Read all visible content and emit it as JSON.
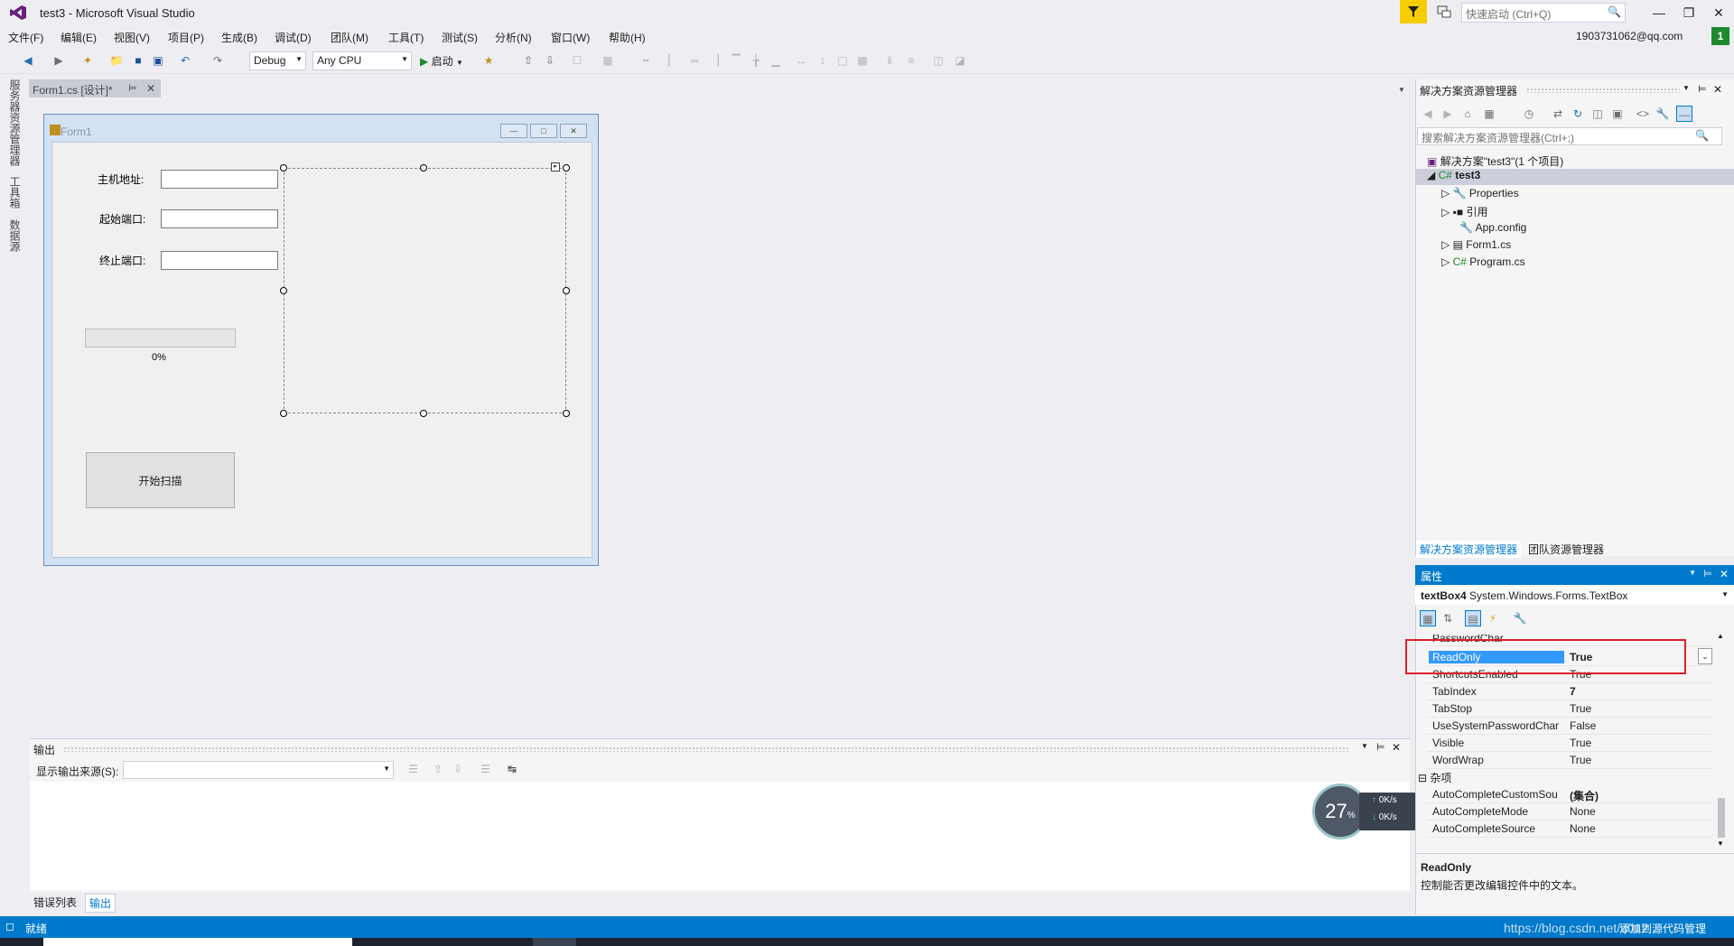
{
  "window": {
    "title": "test3 - Microsoft Visual Studio",
    "quick_launch_placeholder": "快速启动 (Ctrl+Q)",
    "account": "1903731062@qq.com",
    "notification_count": "1"
  },
  "menu": [
    "文件(F)",
    "编辑(E)",
    "视图(V)",
    "项目(P)",
    "生成(B)",
    "调试(D)",
    "团队(M)",
    "工具(T)",
    "测试(S)",
    "分析(N)",
    "窗口(W)",
    "帮助(H)"
  ],
  "toolbar": {
    "config": "Debug",
    "platform": "Any CPU",
    "start": "启动"
  },
  "left_tabs": [
    "服务器资源管理器",
    "工具箱",
    "数据源"
  ],
  "doc_tab": {
    "label": "Form1.cs [设计]*"
  },
  "form": {
    "title": "Form1",
    "host_label": "主机地址:",
    "start_port_label": "起始端口:",
    "end_port_label": "终止端口:",
    "progress_text": "0%",
    "progress_value": 0,
    "scan_button": "开始扫描"
  },
  "output": {
    "title": "输出",
    "source_label": "显示输出来源(S):",
    "tabs": [
      "错误列表",
      "输出"
    ]
  },
  "speed_widget": {
    "cpu": "27",
    "unit": "%",
    "up": "0K/s",
    "down": "0K/s"
  },
  "solution_explorer": {
    "title": "解决方案资源管理器",
    "search_placeholder": "搜索解决方案资源管理器(Ctrl+;)",
    "solution": "解决方案\"test3\"(1 个项目)",
    "project": "test3",
    "items": [
      "Properties",
      "引用",
      "App.config",
      "Form1.cs",
      "Program.cs"
    ],
    "tabs": [
      "解决方案资源管理器",
      "团队资源管理器"
    ]
  },
  "properties": {
    "title": "属性",
    "object_name": "textBox4",
    "object_type": "System.Windows.Forms.TextBox",
    "rows": [
      {
        "name": "PasswordChar",
        "value": ""
      },
      {
        "name": "ReadOnly",
        "value": "True"
      },
      {
        "name": "ShortcutsEnabled",
        "value": "True"
      },
      {
        "name": "TabIndex",
        "value": "7"
      },
      {
        "name": "TabStop",
        "value": "True"
      },
      {
        "name": "UseSystemPasswordChar",
        "value": "False"
      },
      {
        "name": "Visible",
        "value": "True"
      },
      {
        "name": "WordWrap",
        "value": "True"
      }
    ],
    "category": "杂项",
    "misc_rows": [
      {
        "name": "AutoCompleteCustomSou",
        "value": "(集合)"
      },
      {
        "name": "AutoCompleteMode",
        "value": "None"
      },
      {
        "name": "AutoCompleteSource",
        "value": "None"
      }
    ],
    "desc_title": "ReadOnly",
    "desc_text": "控制能否更改编辑控件中的文本。"
  },
  "status": {
    "text": "就绪",
    "right_text": "添加到源代码管理"
  },
  "watermark": "https://blog.csdn.net/u012...",
  "colors": {
    "accent": "#007ACC",
    "highlight_box": "#E01E2A",
    "filter": "#F5CC00"
  }
}
